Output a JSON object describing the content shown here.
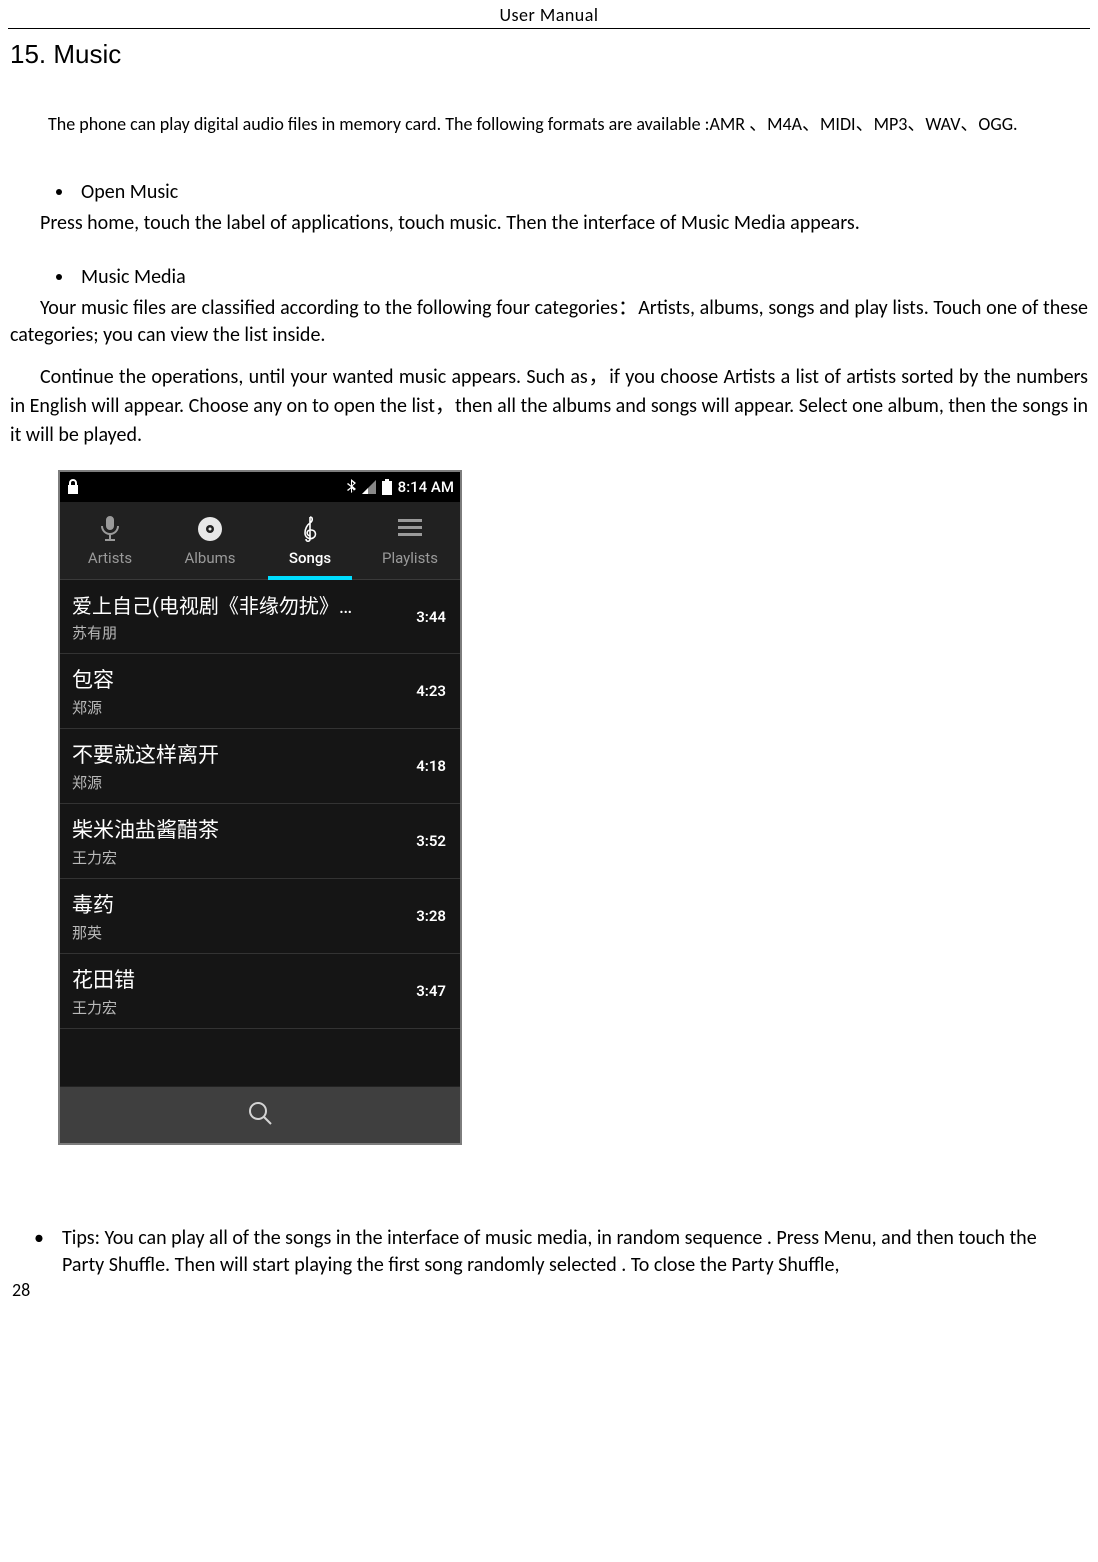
{
  "header": "User    Manual",
  "section_title": "15. Music",
  "intro": "The  phone can play digital audio files in memory card. The following formats are available :AMR 、M4A、MIDI、MP3、WAV、OGG.",
  "bullets": {
    "open_music": "Open Music",
    "music_media": "Music Media"
  },
  "paragraphs": {
    "p1": "Press home, touch the label of applications, touch music. Then the interface of Music Media appears.",
    "p2": "Your music files are classified according to the following four categories：Artists, albums, songs and play lists. Touch one of these categories; you can view the list inside.",
    "p3": "Continue the operations, until your wanted music appears. Such as，if you choose Artists a list of artists sorted by the numbers in English will appear. Choose any on to open the list，then all the albums and songs will appear. Select one album, then the songs in it will be played."
  },
  "tips": "Tips: You can play all of the songs in the interface of music media, in random sequence . Press Menu, and then touch the Party Shuffle. Then will start playing the first song randomly selected . To close the Party Shuffle,",
  "page_number": "28",
  "phone": {
    "status_time": "8:14 AM",
    "tabs": {
      "artists": "Artists",
      "albums": "Albums",
      "songs": "Songs",
      "playlists": "Playlists"
    },
    "songs": [
      {
        "title": "爱上自己(电视剧《非缘勿扰》片…",
        "artist": "苏有朋",
        "duration": "3:44"
      },
      {
        "title": "包容",
        "artist": "郑源",
        "duration": "4:23"
      },
      {
        "title": "不要就这样离开",
        "artist": "郑源",
        "duration": "4:18"
      },
      {
        "title": "柴米油盐酱醋茶",
        "artist": "王力宏",
        "duration": "3:52"
      },
      {
        "title": "毒药",
        "artist": "那英",
        "duration": "3:28"
      },
      {
        "title": "花田错",
        "artist": "王力宏",
        "duration": "3:47"
      }
    ]
  }
}
